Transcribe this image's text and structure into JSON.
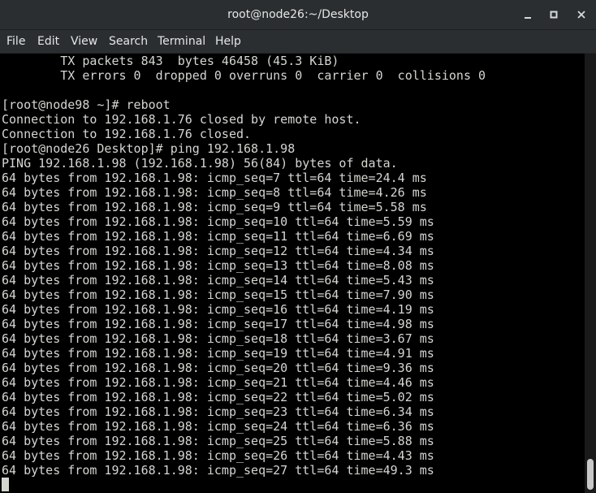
{
  "window": {
    "title": "root@node26:~/Desktop"
  },
  "menu": {
    "file": "File",
    "edit": "Edit",
    "view": "View",
    "search": "Search",
    "terminal": "Terminal",
    "help": "Help"
  },
  "terminal": {
    "lines": [
      "        TX packets 843  bytes 46458 (45.3 KiB)",
      "        TX errors 0  dropped 0 overruns 0  carrier 0  collisions 0",
      "",
      "[root@node98 ~]# reboot",
      "Connection to 192.168.1.76 closed by remote host.",
      "Connection to 192.168.1.76 closed.",
      "[root@node26 Desktop]# ping 192.168.1.98",
      "PING 192.168.1.98 (192.168.1.98) 56(84) bytes of data.",
      "64 bytes from 192.168.1.98: icmp_seq=7 ttl=64 time=24.4 ms",
      "64 bytes from 192.168.1.98: icmp_seq=8 ttl=64 time=4.26 ms",
      "64 bytes from 192.168.1.98: icmp_seq=9 ttl=64 time=5.58 ms",
      "64 bytes from 192.168.1.98: icmp_seq=10 ttl=64 time=5.59 ms",
      "64 bytes from 192.168.1.98: icmp_seq=11 ttl=64 time=6.69 ms",
      "64 bytes from 192.168.1.98: icmp_seq=12 ttl=64 time=4.34 ms",
      "64 bytes from 192.168.1.98: icmp_seq=13 ttl=64 time=8.08 ms",
      "64 bytes from 192.168.1.98: icmp_seq=14 ttl=64 time=5.43 ms",
      "64 bytes from 192.168.1.98: icmp_seq=15 ttl=64 time=7.90 ms",
      "64 bytes from 192.168.1.98: icmp_seq=16 ttl=64 time=4.19 ms",
      "64 bytes from 192.168.1.98: icmp_seq=17 ttl=64 time=4.98 ms",
      "64 bytes from 192.168.1.98: icmp_seq=18 ttl=64 time=3.67 ms",
      "64 bytes from 192.168.1.98: icmp_seq=19 ttl=64 time=4.91 ms",
      "64 bytes from 192.168.1.98: icmp_seq=20 ttl=64 time=9.36 ms",
      "64 bytes from 192.168.1.98: icmp_seq=21 ttl=64 time=4.46 ms",
      "64 bytes from 192.168.1.98: icmp_seq=22 ttl=64 time=5.02 ms",
      "64 bytes from 192.168.1.98: icmp_seq=23 ttl=64 time=6.34 ms",
      "64 bytes from 192.168.1.98: icmp_seq=24 ttl=64 time=6.36 ms",
      "64 bytes from 192.168.1.98: icmp_seq=25 ttl=64 time=5.88 ms",
      "64 bytes from 192.168.1.98: icmp_seq=26 ttl=64 time=4.43 ms",
      "64 bytes from 192.168.1.98: icmp_seq=27 ttl=64 time=49.3 ms"
    ]
  },
  "colors": {
    "titlebar_bg": "#2b2e30",
    "terminal_bg": "#000000",
    "terminal_fg": "#d3d7cf"
  },
  "icons": {
    "minimize": "minimize-icon",
    "maximize": "maximize-icon",
    "close": "close-icon"
  }
}
